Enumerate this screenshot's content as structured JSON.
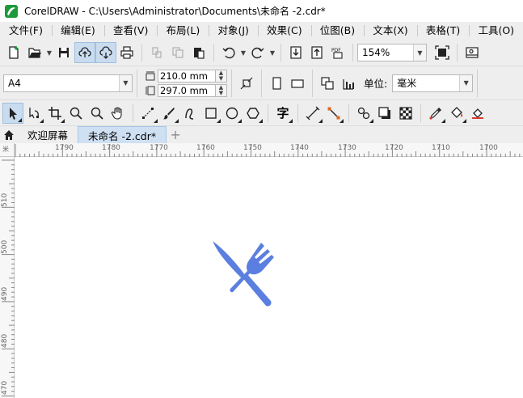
{
  "window": {
    "title": "CorelDRAW - C:\\Users\\Administrator\\Documents\\未命名 -2.cdr*"
  },
  "menu": [
    {
      "label": "文件(F)"
    },
    {
      "label": "编辑(E)"
    },
    {
      "label": "查看(V)"
    },
    {
      "label": "布局(L)"
    },
    {
      "label": "对象(J)"
    },
    {
      "label": "效果(C)"
    },
    {
      "label": "位图(B)"
    },
    {
      "label": "文本(X)"
    },
    {
      "label": "表格(T)"
    },
    {
      "label": "工具(O)"
    }
  ],
  "standard_toolbar": {
    "zoom_value": "154%",
    "pdf_label": "PDF"
  },
  "property_bar": {
    "page_size": "A4",
    "width": "210.0 mm",
    "height": "297.0 mm",
    "unit_label": "单位:",
    "unit_value": "毫米"
  },
  "tools": {
    "text_tool_glyph": "字"
  },
  "doc_tabs": [
    {
      "label": "欢迎屏幕",
      "active": false
    },
    {
      "label": "未命名 -2.cdr*",
      "active": true
    }
  ],
  "add_tab_glyph": "+",
  "ruler": {
    "unit_corner": "米",
    "horizontal_ticks": [
      "1790",
      "1780",
      "1770",
      "1760",
      "1750",
      "1740",
      "1730",
      "1720",
      "1710",
      "1700"
    ],
    "vertical_ticks": [
      "510",
      "500",
      "490",
      "480",
      "470"
    ]
  },
  "colors": {
    "accent": "#5b7fe0",
    "toolbar_bg": "#eeeeee",
    "tab_active": "#cfe0f3",
    "pressed": "#c9dcef"
  }
}
